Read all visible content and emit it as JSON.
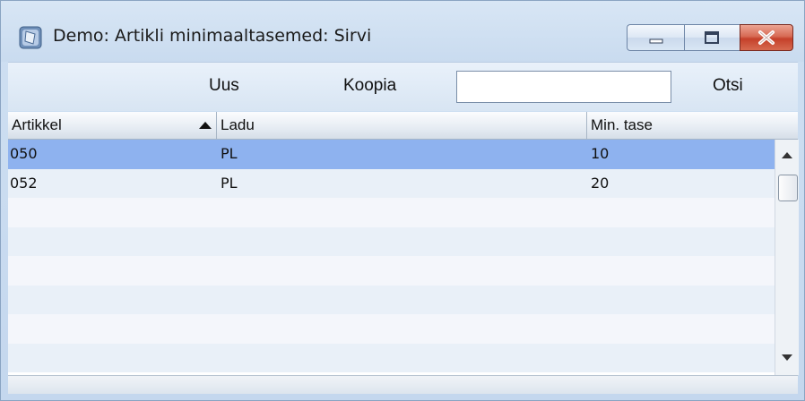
{
  "window": {
    "title": "Demo: Artikli minimaaltasemed: Sirvi",
    "icon": "app-icon"
  },
  "toolbar": {
    "new_label": "Uus",
    "copy_label": "Koopia",
    "search_value": "",
    "search_label": "Otsi"
  },
  "table": {
    "columns": [
      "Artikkel",
      "Ladu",
      "Min. tase"
    ],
    "sort_column": "Artikkel",
    "sort_direction": "ascending",
    "rows": [
      {
        "artikkel": "050",
        "ladu": "PL",
        "min_tase": "10",
        "selected": true
      },
      {
        "artikkel": "052",
        "ladu": "PL",
        "min_tase": "20",
        "selected": false
      }
    ]
  },
  "colors": {
    "selected_row": "#8eb2ef",
    "stripe_light": "#f4f6fb",
    "stripe_alt": "#e9f0f8",
    "close_button": "#c94a33"
  }
}
